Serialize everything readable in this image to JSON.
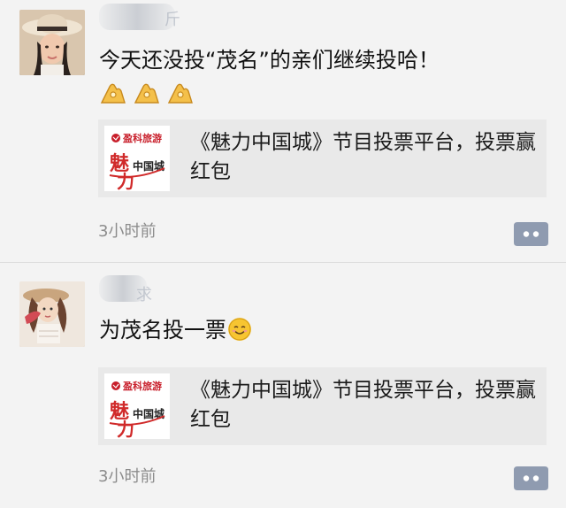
{
  "posts": [
    {
      "text": "今天还没投“茂名”的亲们继续投哈！",
      "emojis": [
        "👌",
        "👌",
        "👌"
      ],
      "link": {
        "title": "《魅力中国城》节目投票平台，投票赢红包",
        "thumb_brand": "盈科旅游",
        "thumb_logo_a": "魅",
        "thumb_logo_b": "力",
        "thumb_logo_c": "中国城"
      },
      "time": "3小时前"
    },
    {
      "text": "为茂名投一票",
      "emoji_icon": "smiling-face-icon",
      "link": {
        "title": "《魅力中国城》节目投票平台，投票赢红包",
        "thumb_brand": "盈科旅游",
        "thumb_logo_a": "魅",
        "thumb_logo_b": "力",
        "thumb_logo_c": "中国城"
      },
      "time": "3小时前"
    }
  ],
  "colors": {
    "background": "#f3f3f3",
    "card": "#e9e9e9",
    "comment_button": "#8f9bb0",
    "timestamp": "#8c8c8c",
    "brand_red": "#c81e2a"
  }
}
